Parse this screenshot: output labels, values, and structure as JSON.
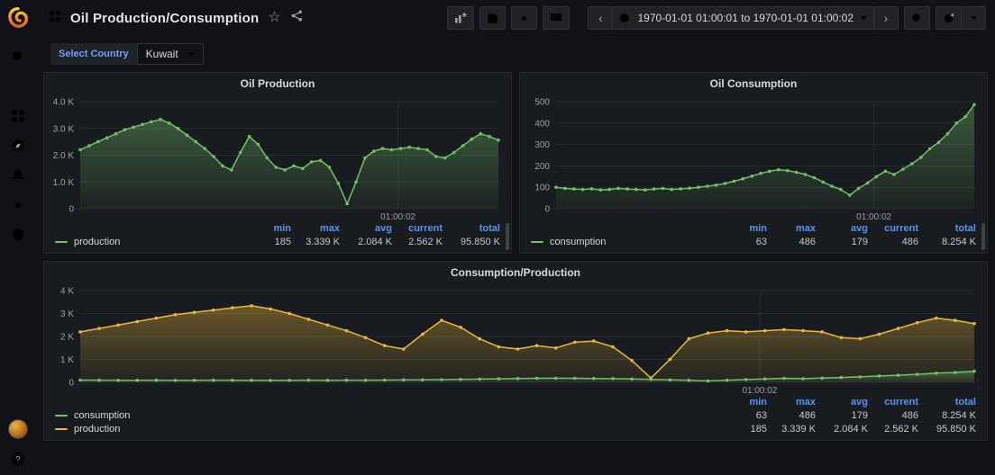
{
  "colors": {
    "accent_blue": "#5794f2",
    "series_green": "#73bf69",
    "series_yellow": "#eab839",
    "brand_orange": "#f05a28",
    "page_bg": "#111217",
    "panel_bg": "#181b1f"
  },
  "icons": {
    "star": "☆",
    "chevron_left": "‹",
    "chevron_right": "›",
    "question": "?"
  },
  "navbar": {
    "title": "Oil Production/Consumption",
    "time_range": "1970-01-01 01:00:01 to 1970-01-01 01:00:02"
  },
  "variables": {
    "label": "Select Country",
    "value": "Kuwait"
  },
  "legend_headers": [
    "min",
    "max",
    "avg",
    "current",
    "total"
  ],
  "chart_data": [
    {
      "type": "area",
      "title": "Oil Production",
      "ylim": [
        0,
        4000
      ],
      "yticks": [
        {
          "v": 0,
          "label": "0"
        },
        {
          "v": 1000,
          "label": "1.0 K"
        },
        {
          "v": 2000,
          "label": "2.0 K"
        },
        {
          "v": 3000,
          "label": "3.0 K"
        },
        {
          "v": 4000,
          "label": "4.0 K"
        }
      ],
      "x_tick": {
        "label": "01:00:02",
        "pos": 0.76
      },
      "series": [
        {
          "name": "production",
          "color": "#73bf69",
          "values": [
            2200,
            2350,
            2500,
            2650,
            2800,
            2950,
            3050,
            3150,
            3250,
            3339,
            3200,
            3000,
            2750,
            2500,
            2250,
            1950,
            1600,
            1450,
            2100,
            2700,
            2400,
            1900,
            1550,
            1450,
            1600,
            1500,
            1750,
            1800,
            1550,
            950,
            185,
            1000,
            1900,
            2150,
            2250,
            2200,
            2250,
            2300,
            2250,
            2200,
            1950,
            1900,
            2100,
            2350,
            2600,
            2800,
            2700,
            2562
          ]
        }
      ],
      "legend": [
        {
          "name": "production",
          "min": "185",
          "max": "3.339 K",
          "avg": "2.084 K",
          "current": "2.562 K",
          "total": "95.850 K"
        }
      ]
    },
    {
      "type": "area",
      "title": "Oil Consumption",
      "ylim": [
        0,
        500
      ],
      "yticks": [
        {
          "v": 0,
          "label": "0"
        },
        {
          "v": 100,
          "label": "100"
        },
        {
          "v": 200,
          "label": "200"
        },
        {
          "v": 300,
          "label": "300"
        },
        {
          "v": 400,
          "label": "400"
        },
        {
          "v": 500,
          "label": "500"
        }
      ],
      "x_tick": {
        "label": "01:00:02",
        "pos": 0.76
      },
      "series": [
        {
          "name": "consumption",
          "color": "#73bf69",
          "values": [
            100,
            95,
            92,
            90,
            93,
            88,
            90,
            95,
            92,
            90,
            88,
            92,
            95,
            90,
            93,
            96,
            100,
            105,
            110,
            118,
            128,
            140,
            152,
            165,
            175,
            182,
            178,
            170,
            160,
            145,
            125,
            105,
            90,
            63,
            95,
            120,
            150,
            175,
            160,
            185,
            210,
            240,
            280,
            310,
            350,
            400,
            430,
            486
          ]
        }
      ],
      "legend": [
        {
          "name": "consumption",
          "min": "63",
          "max": "486",
          "avg": "179",
          "current": "486",
          "total": "8.254 K"
        }
      ]
    },
    {
      "type": "area",
      "title": "Consumption/Production",
      "ylim": [
        0,
        4000
      ],
      "yticks": [
        {
          "v": 0,
          "label": "0"
        },
        {
          "v": 1000,
          "label": "1 K"
        },
        {
          "v": 2000,
          "label": "2 K"
        },
        {
          "v": 3000,
          "label": "3 K"
        },
        {
          "v": 4000,
          "label": "4 K"
        }
      ],
      "x_tick": {
        "label": "01:00:02",
        "pos": 0.76
      },
      "series": [
        {
          "name": "production",
          "color": "#eab839",
          "values": [
            2200,
            2350,
            2500,
            2650,
            2800,
            2950,
            3050,
            3150,
            3250,
            3339,
            3200,
            3000,
            2750,
            2500,
            2250,
            1950,
            1600,
            1450,
            2100,
            2700,
            2400,
            1900,
            1550,
            1450,
            1600,
            1500,
            1750,
            1800,
            1550,
            950,
            185,
            1000,
            1900,
            2150,
            2250,
            2200,
            2250,
            2300,
            2250,
            2200,
            1950,
            1900,
            2100,
            2350,
            2600,
            2800,
            2700,
            2562
          ]
        },
        {
          "name": "consumption",
          "color": "#73bf69",
          "values": [
            100,
            95,
            92,
            90,
            93,
            88,
            90,
            95,
            92,
            90,
            88,
            92,
            95,
            90,
            93,
            96,
            100,
            105,
            110,
            118,
            128,
            140,
            152,
            165,
            175,
            182,
            178,
            170,
            160,
            145,
            125,
            105,
            90,
            63,
            95,
            120,
            150,
            175,
            160,
            185,
            210,
            240,
            280,
            310,
            350,
            400,
            430,
            486
          ]
        }
      ],
      "legend": [
        {
          "name": "consumption",
          "min": "63",
          "max": "486",
          "avg": "179",
          "current": "486",
          "total": "8.254 K"
        },
        {
          "name": "production",
          "min": "185",
          "max": "3.339 K",
          "avg": "2.084 K",
          "current": "2.562 K",
          "total": "95.850 K"
        }
      ]
    }
  ]
}
